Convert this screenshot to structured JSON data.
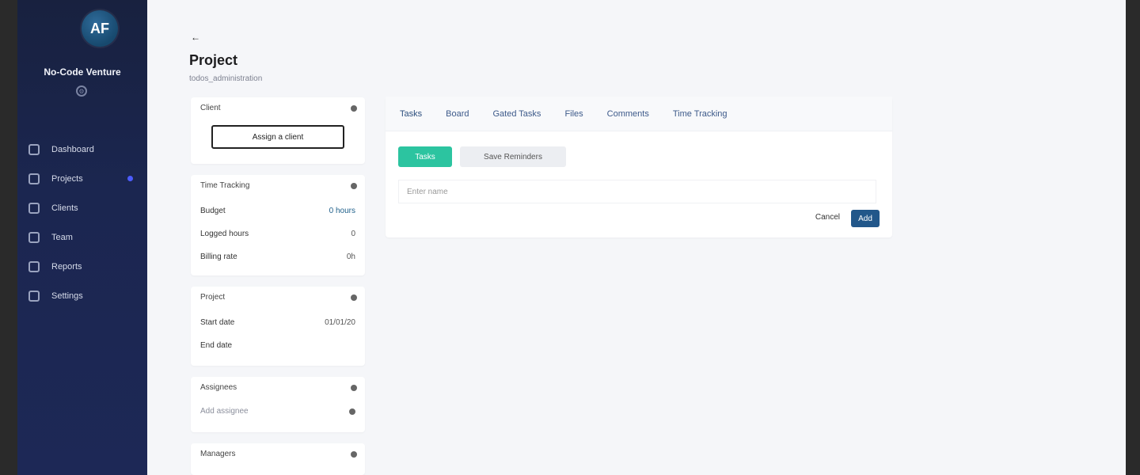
{
  "sidebar": {
    "avatar_initials": "AF",
    "org_name": "No-Code Venture",
    "items": [
      {
        "label": "Dashboard",
        "icon": "home-icon"
      },
      {
        "label": "Projects",
        "icon": "projects-icon",
        "badge": true
      },
      {
        "label": "Clients",
        "icon": "clients-icon"
      },
      {
        "label": "Team",
        "icon": "team-icon"
      },
      {
        "label": "Reports",
        "icon": "reports-icon"
      },
      {
        "label": "Settings",
        "icon": "settings-icon"
      }
    ]
  },
  "header": {
    "back_label": "←",
    "title": "Project",
    "subtitle": "todos_administration"
  },
  "left_panel": {
    "client": {
      "title": "Client",
      "assign_label": "Assign a client"
    },
    "time_tracking": {
      "title": "Time Tracking",
      "rows": [
        {
          "label": "Budget",
          "value": "0 hours"
        },
        {
          "label": "Logged hours",
          "value": "0"
        },
        {
          "label": "Billing rate",
          "value": "0h"
        }
      ]
    },
    "project": {
      "title": "Project",
      "rows": [
        {
          "label": "Start date",
          "value": "01/01/20"
        },
        {
          "label": "End date",
          "value": ""
        }
      ]
    },
    "assignees": {
      "title": "Assignees",
      "placeholder": "Add assignee"
    },
    "managers": {
      "title": "Managers"
    }
  },
  "tabs_card": {
    "tabs": [
      "Tasks",
      "Board",
      "Gated Tasks",
      "Files",
      "Comments",
      "Time Tracking"
    ],
    "tasks_button": "Tasks",
    "save_button": "Save Reminders",
    "task_placeholder": "Enter name",
    "cancel_label": "Cancel",
    "add_label": "Add"
  },
  "colors": {
    "sidebar_bg": "#1b2650",
    "accent_teal": "#2cc4a0",
    "accent_blue": "#22578a",
    "badge": "#4c5cff"
  }
}
